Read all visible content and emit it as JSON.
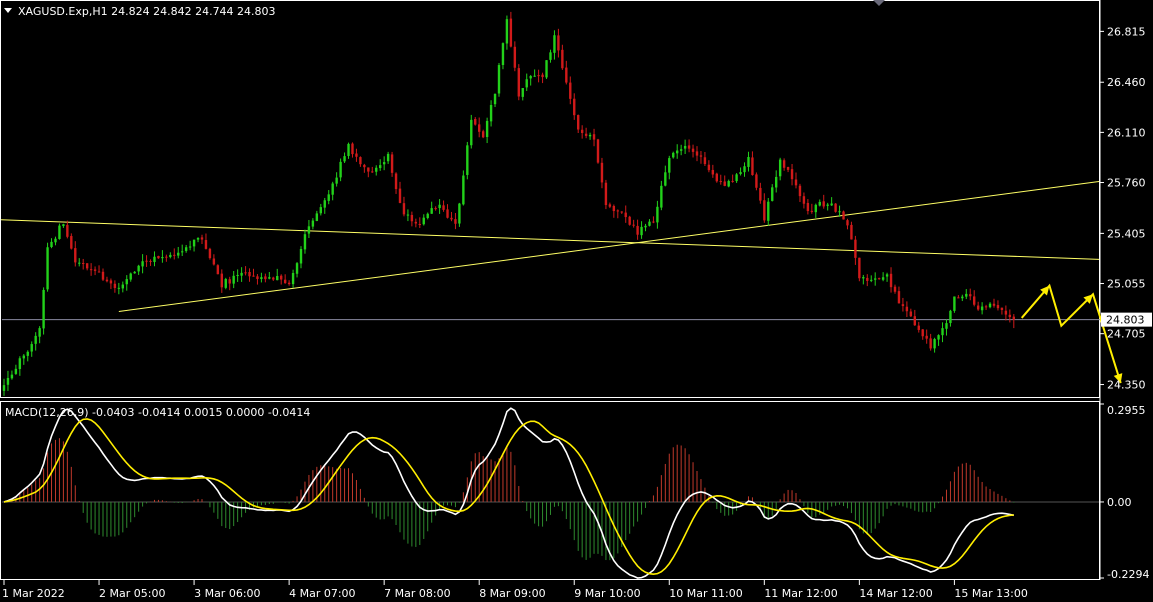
{
  "header": {
    "symbol_line": "XAGUSD.Exp,H1  24.824 24.842 24.744 24.803",
    "macd_label": "MACD(12,26,9) -0.0403 -0.0414 0.0015 0.0000 -0.0414"
  },
  "colors": {
    "background": "#000000",
    "bull": "#22d11a",
    "bear": "#d11a1a",
    "frame": "#ffffff",
    "trendline": "#ffff66",
    "arrow": "#ffee00",
    "macd_main": "#ffffff",
    "macd_signal": "#ffee00",
    "hist_pos": "#c0392b",
    "hist_neg": "#2e8b2e",
    "price_line": "#8a8aa0"
  },
  "chart_data": [
    {
      "type": "candlestick",
      "title": "XAGUSD.Exp,H1",
      "ohlc_last": {
        "open": 24.824,
        "high": 24.842,
        "low": 24.744,
        "close": 24.803
      },
      "current_price": 24.803,
      "current_price_label": "24.803",
      "ylim": [
        24.27,
        27.02
      ],
      "y_ticks": [
        {
          "value": 26.815,
          "label": "26.815"
        },
        {
          "value": 26.46,
          "label": "26.460"
        },
        {
          "value": 26.11,
          "label": "26.110"
        },
        {
          "value": 25.76,
          "label": "25.760"
        },
        {
          "value": 25.405,
          "label": "25.405"
        },
        {
          "value": 25.055,
          "label": "25.055"
        },
        {
          "value": 24.705,
          "label": "24.705"
        },
        {
          "value": 24.35,
          "label": "24.350"
        }
      ],
      "x_ticks": [
        {
          "bar": 0,
          "label": "1 Mar 2022"
        },
        {
          "bar": 24,
          "label": "2 Mar 05:00"
        },
        {
          "bar": 48,
          "label": "3 Mar 06:00"
        },
        {
          "bar": 72,
          "label": "4 Mar 07:00"
        },
        {
          "bar": 96,
          "label": "7 Mar 08:00"
        },
        {
          "bar": 120,
          "label": "8 Mar 09:00"
        },
        {
          "bar": 144,
          "label": "9 Mar 10:00"
        },
        {
          "bar": 168,
          "label": "10 Mar 11:00"
        },
        {
          "bar": 192,
          "label": "11 Mar 12:00"
        },
        {
          "bar": 216,
          "label": "14 Mar 12:00"
        },
        {
          "bar": 240,
          "label": "15 Mar 13:00"
        }
      ],
      "bar_count": 256,
      "close_anchors": [
        [
          0,
          24.35
        ],
        [
          5,
          24.55
        ],
        [
          9,
          24.75
        ],
        [
          11,
          25.3
        ],
        [
          15,
          25.48
        ],
        [
          18,
          25.22
        ],
        [
          24,
          25.12
        ],
        [
          29,
          25.0
        ],
        [
          34,
          25.18
        ],
        [
          40,
          25.25
        ],
        [
          46,
          25.3
        ],
        [
          50,
          25.38
        ],
        [
          55,
          25.05
        ],
        [
          60,
          25.12
        ],
        [
          68,
          25.1
        ],
        [
          72,
          25.05
        ],
        [
          76,
          25.38
        ],
        [
          82,
          25.68
        ],
        [
          87,
          26.02
        ],
        [
          92,
          25.82
        ],
        [
          97,
          25.95
        ],
        [
          100,
          25.6
        ],
        [
          104,
          25.45
        ],
        [
          110,
          25.62
        ],
        [
          114,
          25.45
        ],
        [
          118,
          26.2
        ],
        [
          121,
          26.08
        ],
        [
          124,
          26.4
        ],
        [
          127,
          26.9
        ],
        [
          130,
          26.38
        ],
        [
          133,
          26.5
        ],
        [
          136,
          26.52
        ],
        [
          139,
          26.78
        ],
        [
          142,
          26.45
        ],
        [
          145,
          26.12
        ],
        [
          149,
          26.05
        ],
        [
          152,
          25.6
        ],
        [
          156,
          25.55
        ],
        [
          160,
          25.42
        ],
        [
          164,
          25.48
        ],
        [
          168,
          25.95
        ],
        [
          172,
          26.02
        ],
        [
          176,
          25.92
        ],
        [
          180,
          25.75
        ],
        [
          184,
          25.75
        ],
        [
          188,
          25.92
        ],
        [
          192,
          25.52
        ],
        [
          196,
          25.92
        ],
        [
          199,
          25.8
        ],
        [
          203,
          25.56
        ],
        [
          208,
          25.63
        ],
        [
          213,
          25.48
        ],
        [
          216,
          25.1
        ],
        [
          219,
          25.08
        ],
        [
          223,
          25.12
        ],
        [
          226,
          24.92
        ],
        [
          230,
          24.78
        ],
        [
          234,
          24.62
        ],
        [
          237,
          24.72
        ],
        [
          240,
          24.95
        ],
        [
          243,
          25.0
        ],
        [
          246,
          24.86
        ],
        [
          250,
          24.92
        ],
        [
          253,
          24.82
        ],
        [
          255,
          24.803
        ]
      ],
      "trendlines": [
        {
          "name": "upper-trendline",
          "from": {
            "bar": -1,
            "price": 25.5
          },
          "to": {
            "bar": 280,
            "price": 25.22
          }
        },
        {
          "name": "lower-trendline",
          "from": {
            "bar": 29,
            "price": 24.86
          },
          "to": {
            "bar": 280,
            "price": 25.78
          }
        }
      ],
      "projection_path": [
        {
          "bar": 257,
          "price": 24.815
        },
        {
          "bar": 264,
          "price": 25.04
        },
        {
          "bar": 267,
          "price": 24.76
        },
        {
          "bar": 275,
          "price": 24.98
        },
        {
          "bar": 282,
          "price": 24.36
        }
      ]
    },
    {
      "type": "macd",
      "title": "MACD(12,26,9)",
      "params": [
        12,
        26,
        9
      ],
      "values_last": {
        "main": -0.0403,
        "signal": -0.0414,
        "histogram": 0.0015
      },
      "ylim": [
        -0.2294,
        0.2955
      ],
      "y_ticks": [
        {
          "value": 0.2955,
          "label": "0.2955"
        },
        {
          "value": 0.0,
          "label": "0.00"
        },
        {
          "value": -0.2294,
          "label": "-0.2294"
        }
      ]
    }
  ]
}
